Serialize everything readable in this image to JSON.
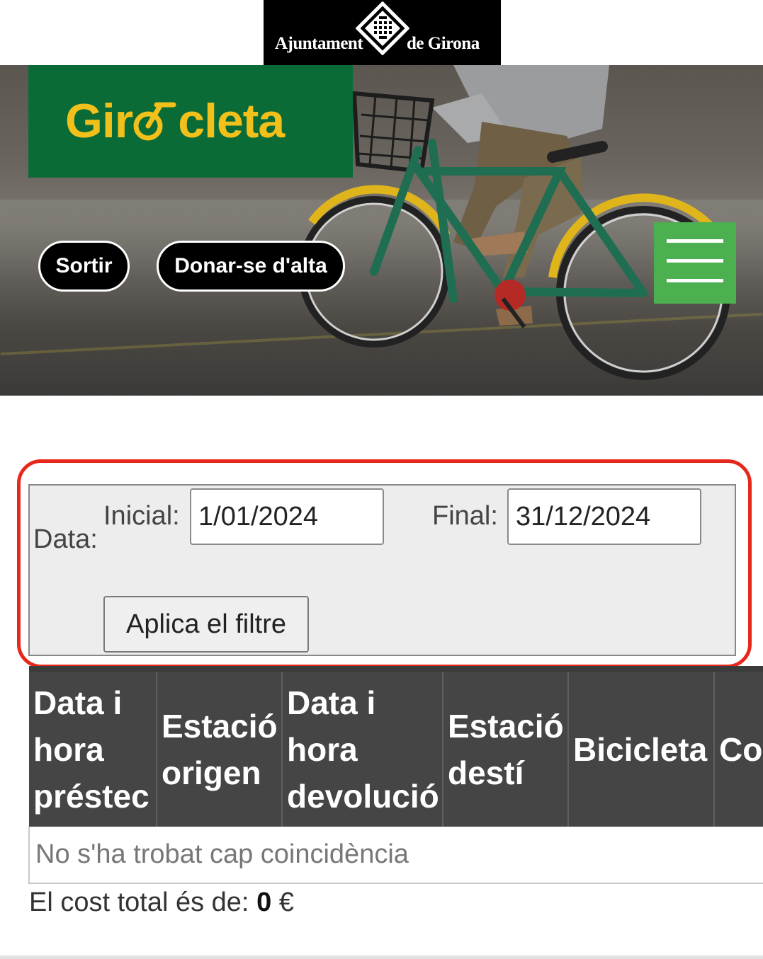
{
  "municipal_header": {
    "left_word": "Ajuntament",
    "right_word": "de Girona",
    "bg_color": "#000000"
  },
  "brand": {
    "name_prefix": "Gir",
    "name_suffix": "cleta",
    "bg_color": "#0a6b37",
    "text_color": "#f2c01a"
  },
  "nav": {
    "logout_label": "Sortir",
    "signup_label": "Donar-se d'alta",
    "menu_icon": "hamburger-icon",
    "menu_color": "#4caf50"
  },
  "filter": {
    "data_label": "Data:",
    "initial_label": "Inicial:",
    "initial_value": "1/01/2024",
    "final_label": "Final:",
    "final_value": "31/12/2024",
    "apply_label": "Aplica el filtre",
    "highlight_color": "#e5281b"
  },
  "table": {
    "headers": [
      "Data i hora préstec",
      "Estació origen",
      "Data i hora devolució",
      "Estació destí",
      "Bicicleta",
      "Cost"
    ],
    "empty_message": "No s'ha trobat cap coincidència"
  },
  "summary": {
    "label": "El cost total és de:",
    "value": "0",
    "currency": "€"
  }
}
